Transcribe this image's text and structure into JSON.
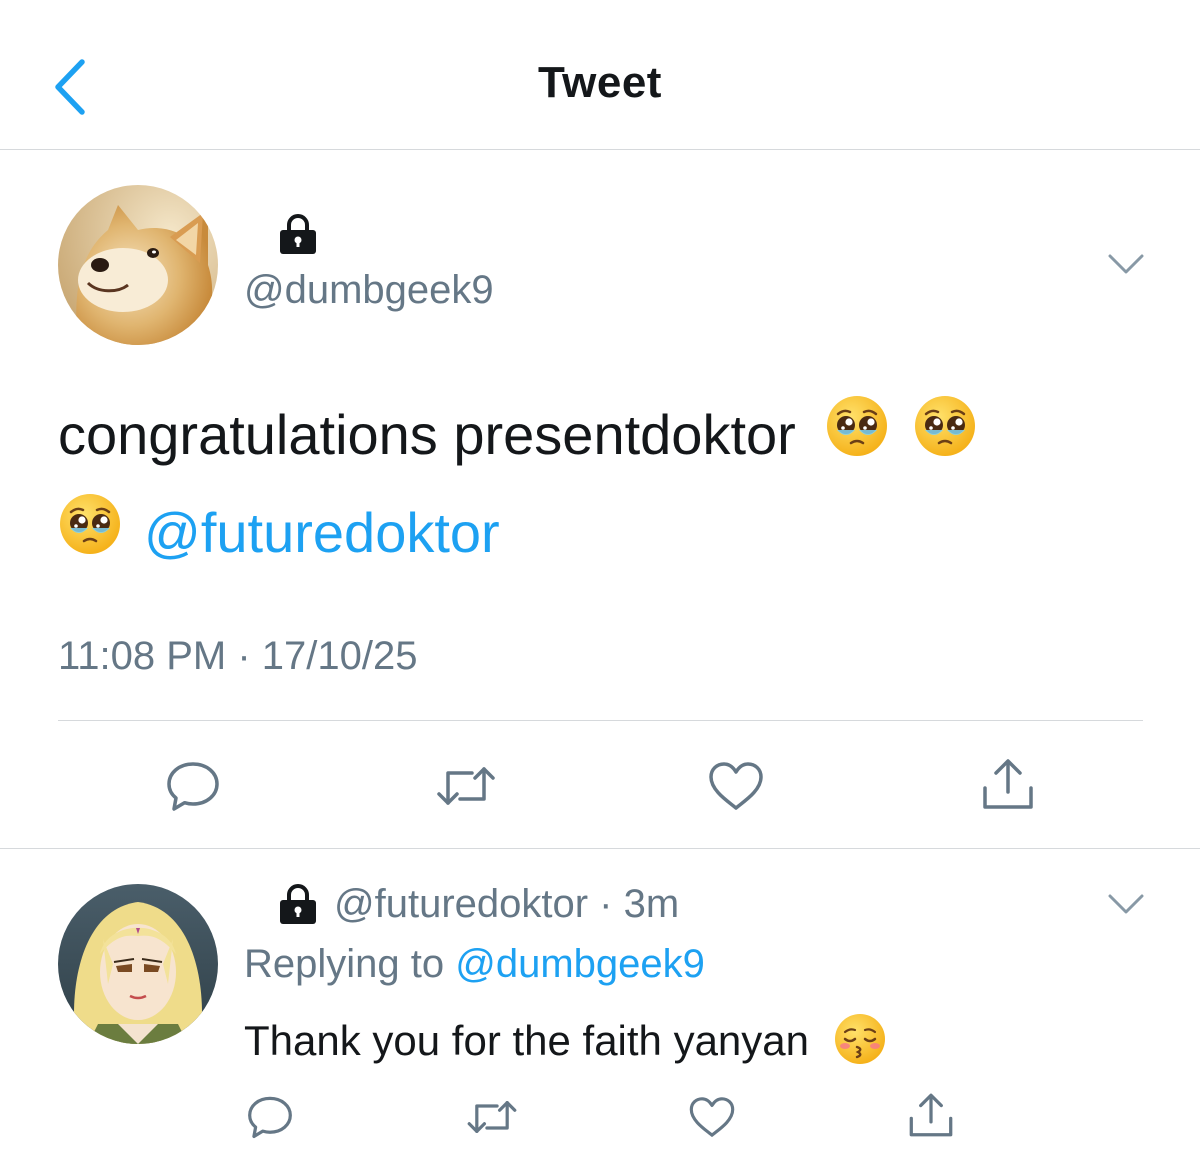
{
  "header": {
    "title": "Tweet",
    "back_icon": "chevron-left-icon"
  },
  "colors": {
    "accent": "#1da1f2",
    "secondary_text": "#657786",
    "primary_text": "#14171a",
    "divider": "#d6d9dc"
  },
  "main_tweet": {
    "protected_icon": "lock-icon",
    "handle": "@dumbgeek9",
    "text": "congratulations presentdoktor",
    "emoji": "pleading-face",
    "mention": "@futuredoktor",
    "timestamp": "11:08 PM · 17/10/25",
    "actions": [
      "reply-icon",
      "retweet-icon",
      "like-icon",
      "share-icon"
    ]
  },
  "reply": {
    "protected_icon": "lock-icon",
    "handle": "@futuredoktor",
    "time_sep": " · ",
    "time": "3m",
    "replying_prefix": "Replying to ",
    "replying_to": "@dumbgeek9",
    "text": "Thank you for the faith yanyan",
    "emoji": "kissing-face-with-closed-eyes",
    "actions": [
      "reply-icon",
      "retweet-icon",
      "like-icon",
      "share-icon"
    ]
  }
}
